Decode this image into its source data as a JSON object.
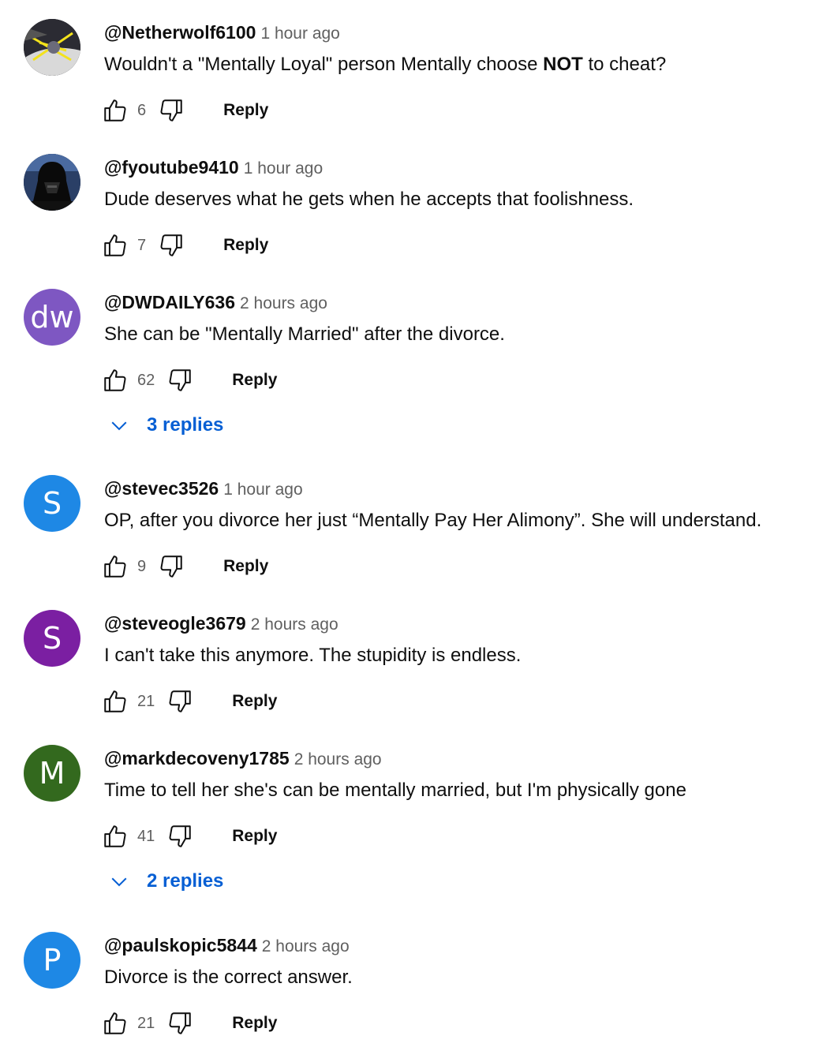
{
  "reply_label": "Reply",
  "colors": {
    "link_blue": "#065fd4",
    "secondary_text": "#606060",
    "avatar_dw": "#7e57c2",
    "avatar_stevec": "#1e88e5",
    "avatar_steveogle": "#7b1fa2",
    "avatar_mark": "#33691e",
    "avatar_paul": "#1e88e5"
  },
  "comments": [
    {
      "author": "@Netherwolf6100",
      "time": "1 hour ago",
      "text_before": "Wouldn't a \"Mentally Loyal\" person Mentally choose ",
      "text_bold": "NOT",
      "text_after": " to cheat?",
      "likes": "6",
      "avatar_icon": "sci-fi-image-avatar"
    },
    {
      "author": "@fyoutube9410",
      "time": "1 hour ago",
      "text": "Dude deserves what he gets when he accepts that foolishness.",
      "likes": "7",
      "avatar_icon": "darth-vader-avatar"
    },
    {
      "author": "@DWDAILY636",
      "time": "2 hours ago",
      "text": "She can be \"Mentally Married\" after the divorce.",
      "likes": "62",
      "avatar_letter": "dw",
      "replies": "3 replies"
    },
    {
      "author": "@stevec3526",
      "time": "1 hour ago",
      "text": "OP, after you divorce her just “Mentally Pay Her Alimony”. She will understand.",
      "likes": "9",
      "avatar_letter": "S"
    },
    {
      "author": "@steveogle3679",
      "time": "2 hours ago",
      "text": "I can't take this anymore. The stupidity is endless.",
      "likes": "21",
      "avatar_letter": "S"
    },
    {
      "author": "@markdecoveny1785",
      "time": "2 hours ago",
      "text": "Time to tell her she's can be mentally married, but I'm physically gone",
      "likes": "41",
      "avatar_letter": "M",
      "replies": "2 replies"
    },
    {
      "author": "@paulskopic5844",
      "time": "2 hours ago",
      "text": "Divorce is the correct answer.",
      "likes": "21",
      "avatar_letter": "P"
    }
  ]
}
